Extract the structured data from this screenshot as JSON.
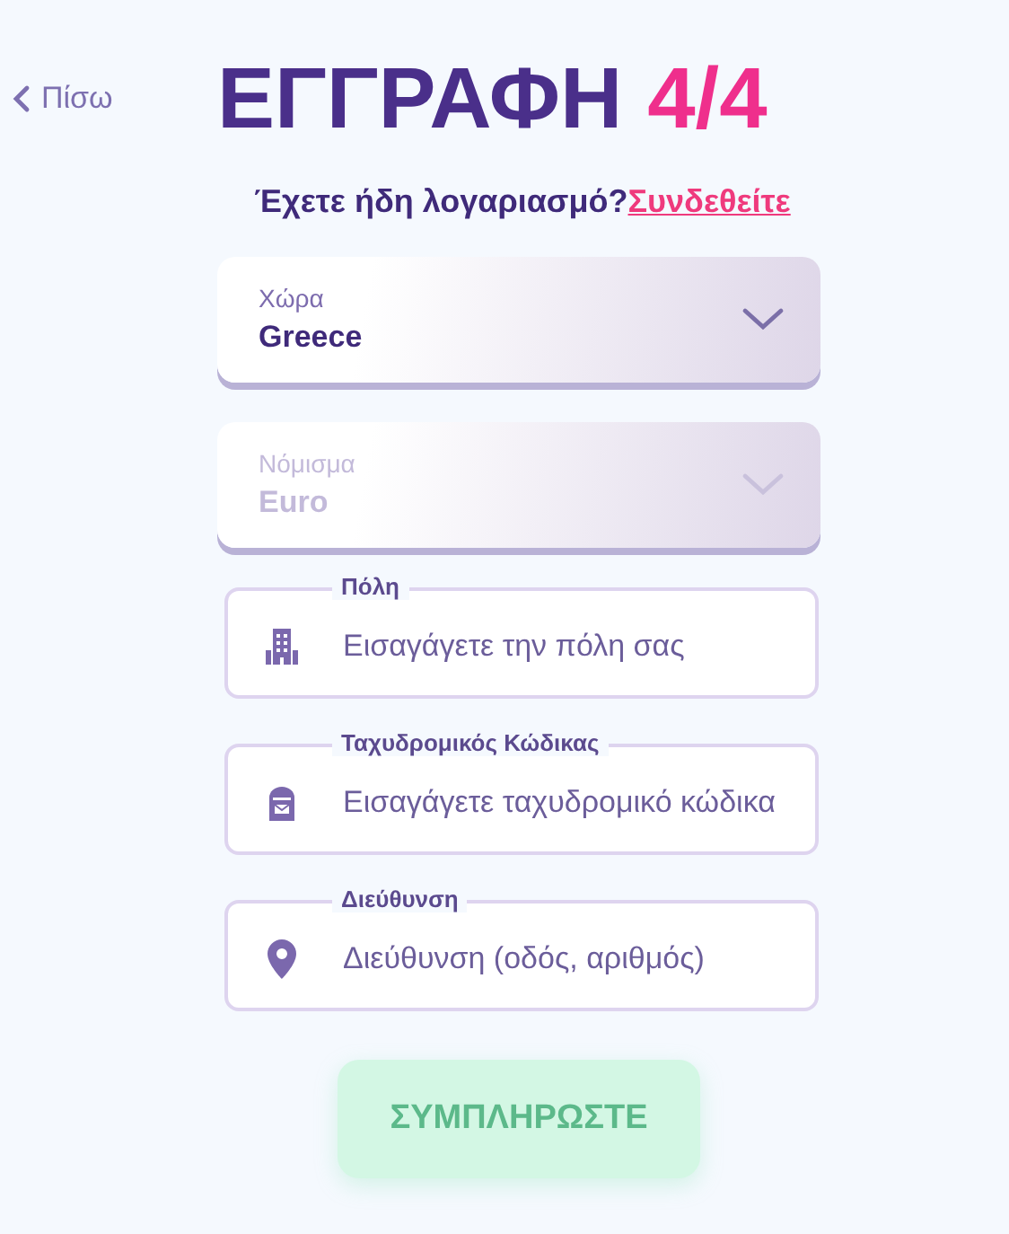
{
  "back_link": {
    "label": "Πίσω"
  },
  "title": {
    "text": "ΕΓΓΡΑΦΗ",
    "step": "4/4"
  },
  "login_prompt": {
    "question": "Έχετε ήδη λογαριασμό?",
    "link": "Συνδεθείτε"
  },
  "selects": [
    {
      "label": "Χώρα",
      "value": "Greece",
      "disabled": false
    },
    {
      "label": "Νόμισμα",
      "value": "Euro",
      "disabled": true
    }
  ],
  "inputs": [
    {
      "label": "Πόλη",
      "placeholder": "Εισαγάγετε την πόλη σας",
      "kind": "building"
    },
    {
      "label": "Ταχυδρομικός Κώδικας",
      "placeholder": "Εισαγάγετε ταχυδρομικό κώδικα",
      "kind": "mailbox"
    },
    {
      "label": "Διεύθυνση",
      "placeholder": "Διεύθυνση (οδός, αριθμός)",
      "kind": "pin"
    }
  ],
  "submit": {
    "label": "ΣΥΜΠΛΗΡΩΣΤΕ",
    "disabled": true
  }
}
